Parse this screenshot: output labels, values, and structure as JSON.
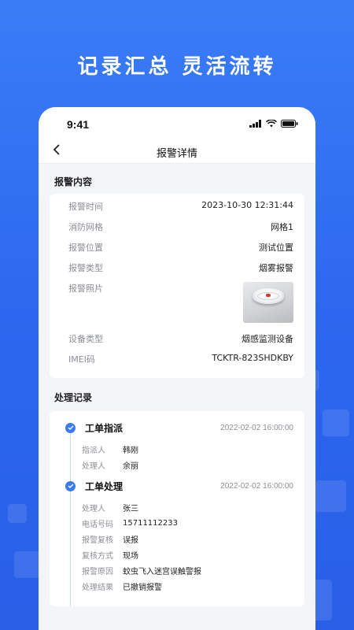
{
  "headline": "记录汇总  灵活流转",
  "status_bar": {
    "time": "9:41"
  },
  "nav": {
    "title": "报警详情"
  },
  "alarm_section": {
    "title": "报警内容",
    "rows": [
      {
        "label": "报警时间",
        "value": "2023-10-30 12:31:44"
      },
      {
        "label": "消防网格",
        "value": "网格1"
      },
      {
        "label": "报警位置",
        "value": "测试位置"
      },
      {
        "label": "报警类型",
        "value": "烟雾报警"
      },
      {
        "label": "报警照片",
        "value": ""
      },
      {
        "label": "设备类型",
        "value": "烟感监测设备"
      },
      {
        "label": "IMEI码",
        "value": "TCKTR-823SHDKBY"
      }
    ]
  },
  "records_section": {
    "title": "处理记录",
    "entries": [
      {
        "title": "工单指派",
        "time": "2022-02-02 16:00:00",
        "fields": [
          {
            "k": "指派人",
            "v": "韩刚"
          },
          {
            "k": "处理人",
            "v": "余丽"
          }
        ]
      },
      {
        "title": "工单处理",
        "time": "2022-02-02 16:00:00",
        "fields": [
          {
            "k": "处理人",
            "v": "张三"
          },
          {
            "k": "电话号码",
            "v": "15711112233"
          },
          {
            "k": "报警复核",
            "v": "误报"
          },
          {
            "k": "复核方式",
            "v": "现场"
          },
          {
            "k": "报警原因",
            "v": "蚊虫飞入迷宫误触警报"
          },
          {
            "k": "处理结果",
            "v": "已撤销报警"
          }
        ]
      }
    ]
  },
  "colors": {
    "accent": "#3a7bf4",
    "background": "#2f6df0"
  }
}
